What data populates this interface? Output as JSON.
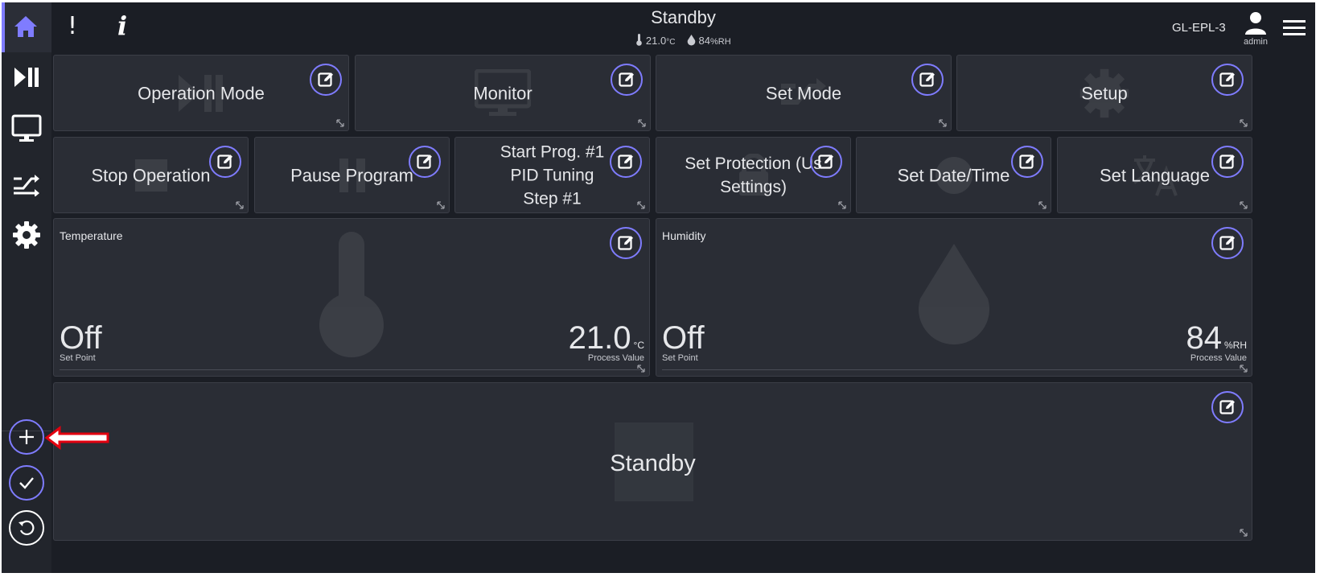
{
  "header": {
    "status": "Standby",
    "temperature": "21.0",
    "temperature_unit": "°C",
    "humidity": "84",
    "humidity_unit": "%RH",
    "device_id": "GL-EPL-3",
    "user": "admin",
    "alert_glyph": "!",
    "info_glyph": "i"
  },
  "sidebar": {
    "items": [
      "home-icon",
      "play-pause-icon",
      "monitor-icon",
      "shuffle-icon",
      "gear-icon"
    ],
    "actions": [
      "add-icon",
      "check-icon",
      "undo-icon"
    ]
  },
  "tiles": {
    "operation_mode": "Operation Mode",
    "monitor": "Monitor",
    "set_mode": "Set Mode",
    "setup": "Setup",
    "stop_operation": "Stop Operation",
    "pause_program": "Pause Program",
    "start_prog_line1": "Start Prog. #1",
    "start_prog_line2": "PID Tuning",
    "start_prog_line3": "Step #1",
    "set_protection_line1": "Set Protection (Us",
    "set_protection_line2": "Settings)",
    "set_datetime": "Set Date/Time",
    "set_language": "Set Language"
  },
  "temperature_widget": {
    "title": "Temperature",
    "set_point_value": "Off",
    "set_point_label": "Set Point",
    "process_value": "21.0",
    "process_unit": "°C",
    "process_label": "Process Value"
  },
  "humidity_widget": {
    "title": "Humidity",
    "set_point_value": "Off",
    "set_point_label": "Set Point",
    "process_value": "84",
    "process_unit": "%RH",
    "process_label": "Process Value"
  },
  "status_widget": {
    "label": "Standby"
  },
  "colors": {
    "accent": "#7f7cff",
    "background": "#1b1e25",
    "tile": "#2a2d35",
    "arrow": "#e3000f"
  }
}
